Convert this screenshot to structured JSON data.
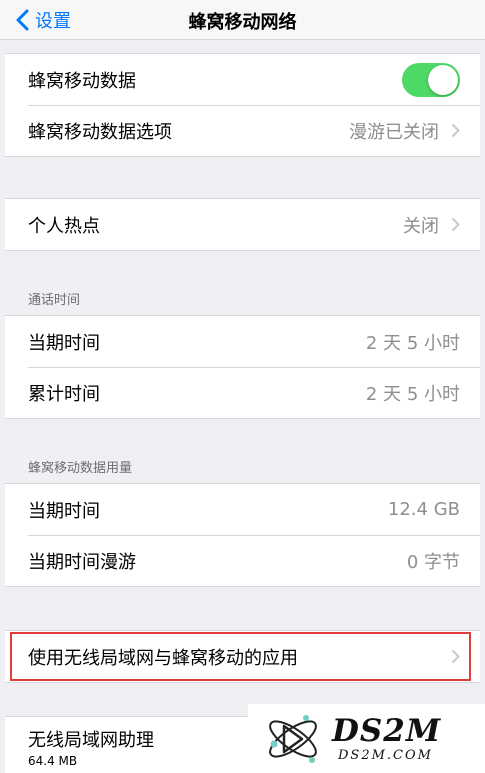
{
  "nav": {
    "back_label": "设置",
    "title": "蜂窝移动网络"
  },
  "group1": {
    "cellular_data_label": "蜂窝移动数据",
    "cellular_data_on": true,
    "options_label": "蜂窝移动数据选项",
    "options_value": "漫游已关闭"
  },
  "group2": {
    "hotspot_label": "个人热点",
    "hotspot_value": "关闭"
  },
  "call_time": {
    "header": "通话时间",
    "current_label": "当期时间",
    "current_value": "2 天 5 小时",
    "lifetime_label": "累计时间",
    "lifetime_value": "2 天 5 小时"
  },
  "usage": {
    "header": "蜂窝移动数据用量",
    "current_label": "当期时间",
    "current_value": "12.4 GB",
    "roaming_label": "当期时间漫游",
    "roaming_value": "0 字节"
  },
  "apps": {
    "label": "使用无线局域网与蜂窝移动的应用"
  },
  "wifi_assist": {
    "label": "无线局域网助理",
    "size": "64.4 MB"
  },
  "watermark": {
    "big": "DS2M",
    "small": "DS2M.COM"
  },
  "colors": {
    "accent": "#007aff",
    "toggle_on": "#4cd964",
    "highlight": "#e03c3c"
  }
}
